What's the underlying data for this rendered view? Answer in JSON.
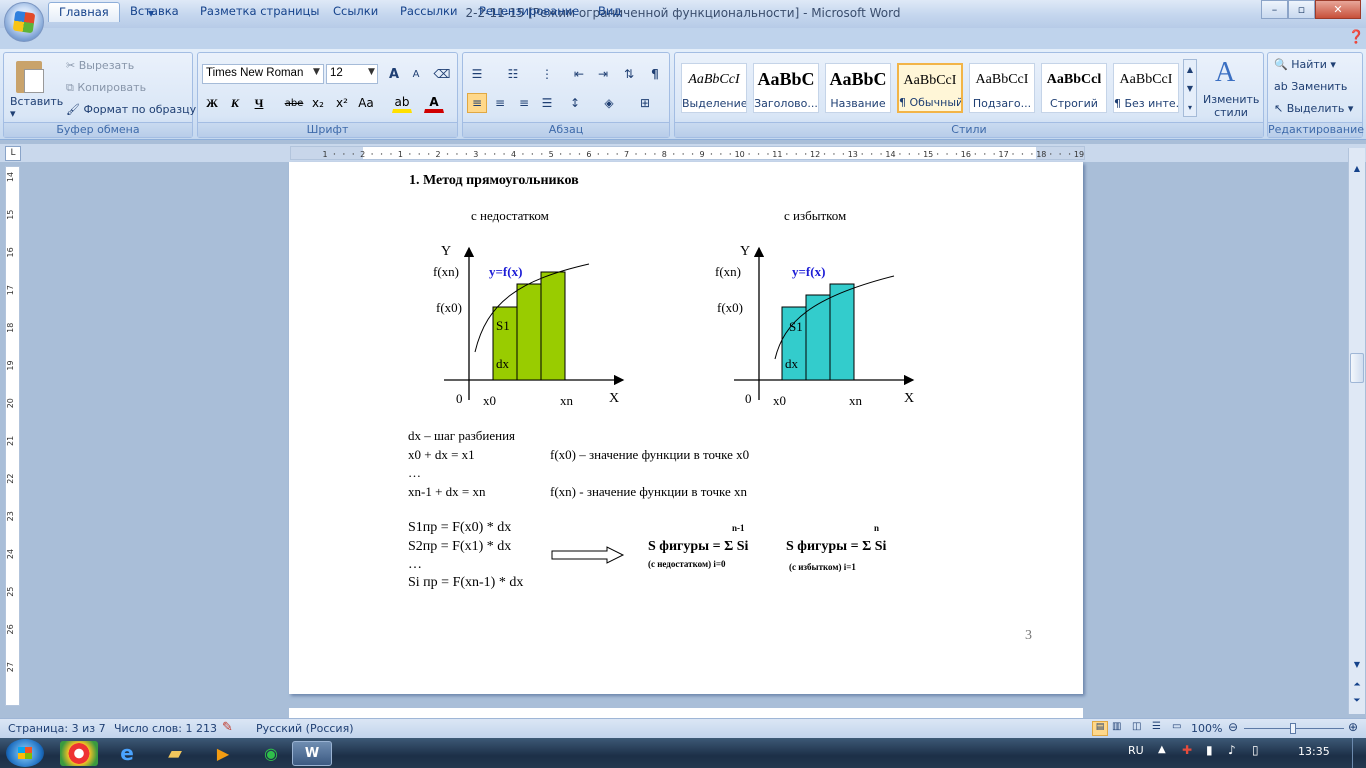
{
  "window": {
    "title": "2-2-11-15 [Режим ограниченной функциональности] - Microsoft Word",
    "minimize": "–",
    "maximize": "▫",
    "close": "✕"
  },
  "tabs": [
    "Главная",
    "Вставка",
    "Разметка страницы",
    "Ссылки",
    "Рассылки",
    "Рецензирование",
    "Вид"
  ],
  "clipboard": {
    "paste": "Вставить",
    "cut": "Вырезать",
    "copy": "Копировать",
    "format_painter": "Формат по образцу",
    "label": "Буфер обмена"
  },
  "font": {
    "family": "Times New Roman",
    "size": "12",
    "label": "Шрифт",
    "bold": "Ж",
    "italic": "К",
    "underline": "Ч",
    "strike": "abe",
    "sub": "x₂",
    "sup": "x²",
    "case": "Aa",
    "grow": "A",
    "shrink": "A",
    "color": "A"
  },
  "paragraph": {
    "label": "Абзац",
    "pilcrow": "¶"
  },
  "styles": {
    "label": "Стили",
    "items": [
      {
        "sample": "AaBbCcI",
        "name": "Выделение"
      },
      {
        "sample": "AaBbC",
        "name": "Заголово..."
      },
      {
        "sample": "AaBbC",
        "name": "Название"
      },
      {
        "sample": "AaBbCcI",
        "name": "¶ Обычный"
      },
      {
        "sample": "AaBbCcI",
        "name": "Подзаго..."
      },
      {
        "sample": "AaBbCcl",
        "name": "Строгий"
      },
      {
        "sample": "AaBbCcI",
        "name": "¶ Без инте..."
      }
    ],
    "change": "Изменить стили"
  },
  "editing": {
    "find": "Найти",
    "replace": "Заменить",
    "select": "Выделить",
    "label": "Редактирование"
  },
  "ruler": {
    "h": [
      "1",
      "2",
      "1",
      "2",
      "3",
      "4",
      "5",
      "6",
      "7",
      "8",
      "9",
      "10",
      "11",
      "12",
      "13",
      "14",
      "15",
      "16",
      "17",
      "18",
      "19"
    ],
    "v": [
      "14",
      "15",
      "16",
      "17",
      "18",
      "19",
      "20",
      "21",
      "22",
      "23",
      "24",
      "25",
      "26",
      "27"
    ]
  },
  "doc": {
    "heading": "1.   Метод прямоугольников",
    "left_caption": "с недостатком",
    "right_caption": "с избытком",
    "chart_left": {
      "y": "Y",
      "fxn": "f(xn)",
      "fx0": "f(x0)",
      "func": "y=f(x)",
      "s1": "S1",
      "dx": "dx",
      "zero": "0",
      "x0": "x0",
      "xn": "xn",
      "x": "X"
    },
    "chart_right": {
      "y": "Y",
      "fxn": "f(xn)",
      "fx0": "f(x0)",
      "func": "y=f(x)",
      "s1": "S1",
      "dx": "dx",
      "zero": "0",
      "x0": "x0",
      "xn": "xn",
      "x": "X"
    },
    "l1": "dx – шаг разбиения",
    "l2a": "x0 + dx = x1",
    "l2b": "f(x0) – значение функции в точке x0",
    "l3": "…",
    "l4a": "xn-1 + dx = xn",
    "l4b": "f(xn) - значение функции в точке xn",
    "s1": "S1пр = F(x0) * dx",
    "s2": "S2пр = F(x1) * dx",
    "s3": "…",
    "s4": "Si пр = F(xn-1) * dx",
    "sum1_top": "n-1",
    "sum1": "S фигуры = Σ Si",
    "sum1_bot": "(с недостатком) i=0",
    "sum2_top": "n",
    "sum2": "S фигуры = Σ Si",
    "sum2_bot": "(с избытком)     i=1",
    "page_num": "3"
  },
  "status": {
    "page": "Страница: 3 из 7",
    "words": "Число слов: 1 213",
    "lang": "Русский (Россия)",
    "zoom": "100%"
  },
  "taskbar": {
    "lang": "RU",
    "time": "13:35"
  }
}
